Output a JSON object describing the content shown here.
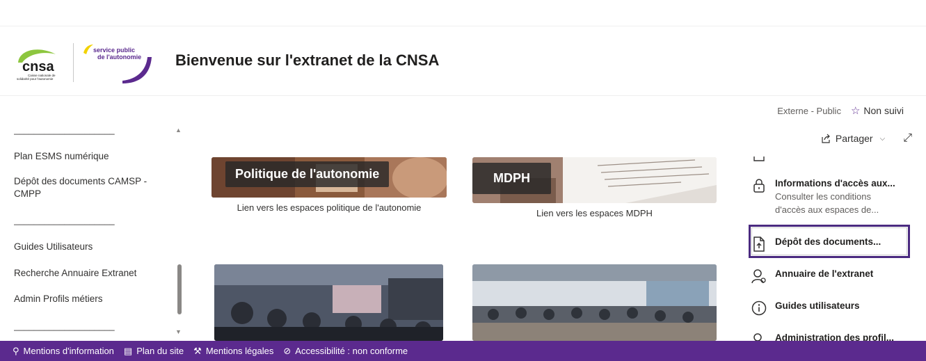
{
  "header": {
    "site_title": "Bienvenue sur l'extranet de la CNSA",
    "logo_cnsa_text": "cnsa",
    "logo_cnsa_sub": "Caisse nationale de solidarité pour l'autonomie",
    "logo_service_text_1": "service public",
    "logo_service_text_2": "de l'autonomie"
  },
  "page_meta": {
    "classification": "Externe - Public",
    "follow_label": "Non suivi"
  },
  "command_bar": {
    "share_label": "Partager"
  },
  "leftnav": {
    "separator": "____________________",
    "items": [
      "Plan ESMS numérique",
      "Dépôt des documents CAMSP - CMPP",
      "Guides Utilisateurs",
      "Recherche Annuaire Extranet",
      "Admin Profils métiers"
    ]
  },
  "tiles": [
    {
      "label": "Politique de l'autonomie",
      "caption": "Lien vers les espaces politique de l'autonomie"
    },
    {
      "label": "MDPH",
      "caption": "Lien vers les espaces MDPH"
    }
  ],
  "quick_links": [
    {
      "title": "Informations d'accès aux...",
      "desc": "Consulter les conditions d'accès aux espaces de...",
      "icon": "lock-icon"
    },
    {
      "title": "Dépôt des documents...",
      "icon": "document-upload-icon"
    },
    {
      "title": "Annuaire de l'extranet",
      "icon": "people-icon"
    },
    {
      "title": "Guides utilisateurs",
      "icon": "info-icon"
    },
    {
      "title": "Administration des profil...",
      "icon": "people-settings-icon"
    }
  ],
  "footer": {
    "items": [
      "Mentions d'information",
      "Plan du site",
      "Mentions légales",
      "Accessibilité : non conforme"
    ]
  },
  "colors": {
    "brand_purple": "#5b2a8e",
    "cnsa_green": "#8dc63f",
    "accent_yellow": "#f2d200"
  }
}
